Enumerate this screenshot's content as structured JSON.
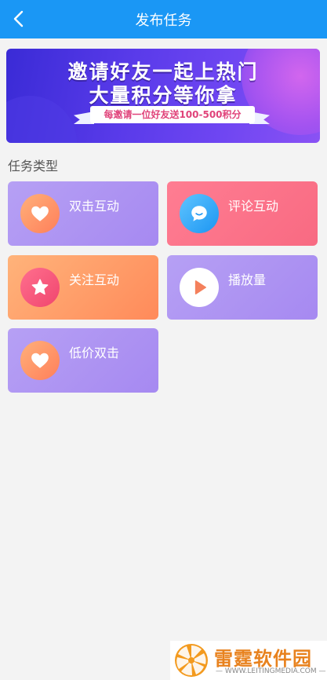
{
  "header": {
    "title": "发布任务"
  },
  "banner": {
    "line1": "邀请好友一起上热门",
    "line2": "大量积分等你拿",
    "ribbon": "每邀请一位好友送100-500积分"
  },
  "section": {
    "label": "任务类型"
  },
  "tasks": [
    {
      "label": "双击互动",
      "icon": "heart-icon"
    },
    {
      "label": "评论互动",
      "icon": "chat-bubble-icon"
    },
    {
      "label": "关注互动",
      "icon": "star-icon"
    },
    {
      "label": "播放量",
      "icon": "play-icon"
    },
    {
      "label": "低价双击",
      "icon": "heart-icon"
    }
  ],
  "watermark": {
    "brand": "雷霆软件园",
    "url": "— WWW.LEITINGMEDIA.COM —"
  },
  "colors": {
    "header": "#1a97f5",
    "purple_card": "#a689f1",
    "pink_card": "#f86a82",
    "orange_card": "#ff8a5a"
  }
}
